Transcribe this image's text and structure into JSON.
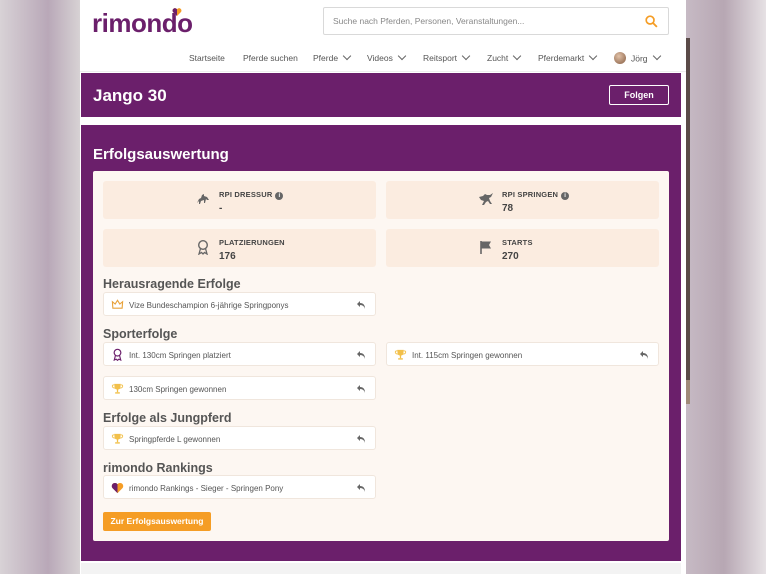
{
  "header": {
    "logo_text": "rimondo",
    "search_placeholder": "Suche nach Pferden, Personen, Veranstaltungen..."
  },
  "nav": {
    "items": [
      {
        "label": "Startseite",
        "dropdown": false
      },
      {
        "label": "Pferde suchen",
        "dropdown": false
      },
      {
        "label": "Pferde",
        "dropdown": true
      },
      {
        "label": "Videos",
        "dropdown": true
      },
      {
        "label": "Reitsport",
        "dropdown": true
      },
      {
        "label": "Zucht",
        "dropdown": true
      },
      {
        "label": "Pferdemarkt",
        "dropdown": true
      }
    ],
    "user": {
      "name": "Jörg"
    }
  },
  "horse": {
    "name": "Jango 30",
    "follow_label": "Folgen"
  },
  "success": {
    "title": "Erfolgsauswertung",
    "stats": [
      {
        "label": "RPI DRESSUR",
        "value": "-",
        "icon": "dressage-horse-icon",
        "info": true
      },
      {
        "label": "RPI SPRINGEN",
        "value": "78",
        "icon": "jumping-horse-icon",
        "info": true
      },
      {
        "label": "PLATZIERUNGEN",
        "value": "176",
        "icon": "rosette-icon",
        "info": false
      },
      {
        "label": "STARTS",
        "value": "270",
        "icon": "flag-icon",
        "info": false
      }
    ],
    "sections": [
      {
        "title": "Herausragende Erfolge",
        "items": [
          {
            "text": "Vize Bundeschampion 6-jährige Springponys",
            "icon": "crown-icon"
          }
        ]
      },
      {
        "title": "Sporterfolge",
        "items": [
          {
            "text": "Int. 130cm Springen platziert",
            "icon": "rosette-icon"
          },
          {
            "text": "Int. 115cm Springen gewonnen",
            "icon": "trophy-icon"
          },
          {
            "text": "130cm Springen gewonnen",
            "icon": "trophy-icon"
          }
        ]
      },
      {
        "title": "Erfolge als Jungpferd",
        "items": [
          {
            "text": "Springpferde L gewonnen",
            "icon": "trophy-icon"
          }
        ]
      },
      {
        "title": "rimondo Rankings",
        "items": [
          {
            "text": "rimondo Rankings - Sieger - Springen Pony",
            "icon": "rimondo-logo-icon"
          }
        ]
      }
    ],
    "cta_label": "Zur Erfolgsauswertung"
  },
  "colors": {
    "brand_purple": "#6b1f6b",
    "accent_orange": "#f59d25",
    "card_bg": "#fdf7f2",
    "stat_bg": "#fbece0"
  }
}
